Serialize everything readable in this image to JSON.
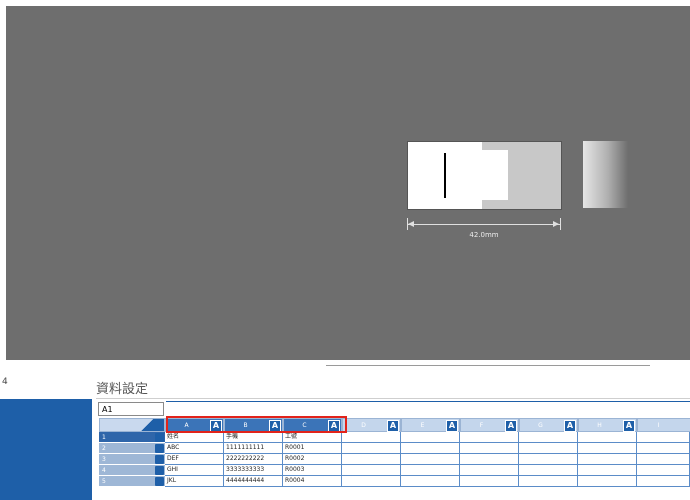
{
  "canvas": {
    "dimension_text": "42.0mm"
  },
  "panel": {
    "left_strip_char": "4",
    "title": "資料設定",
    "cell_ref": "A1"
  },
  "grid": {
    "columns": [
      {
        "letter": "A",
        "badge": "A",
        "selected": true
      },
      {
        "letter": "B",
        "badge": "A",
        "selected": true
      },
      {
        "letter": "C",
        "badge": "A",
        "selected": true
      },
      {
        "letter": "D",
        "badge": "A",
        "selected": false
      },
      {
        "letter": "E",
        "badge": "A",
        "selected": false
      },
      {
        "letter": "F",
        "badge": "A",
        "selected": false
      },
      {
        "letter": "G",
        "badge": "A",
        "selected": false
      },
      {
        "letter": "H",
        "badge": "A",
        "selected": false
      },
      {
        "letter": "I",
        "badge": "",
        "selected": false
      }
    ],
    "rows": [
      {
        "num": "1",
        "cells": [
          "姓名",
          "手機",
          "工號"
        ]
      },
      {
        "num": "2",
        "cells": [
          "ABC",
          "1111111111",
          "R0001"
        ]
      },
      {
        "num": "3",
        "cells": [
          "DEF",
          "2222222222",
          "R0002"
        ]
      },
      {
        "num": "4",
        "cells": [
          "GHI",
          "3333333333",
          "R0003"
        ]
      },
      {
        "num": "5",
        "cells": [
          "JKL",
          "4444444444",
          "R0004"
        ]
      }
    ]
  }
}
